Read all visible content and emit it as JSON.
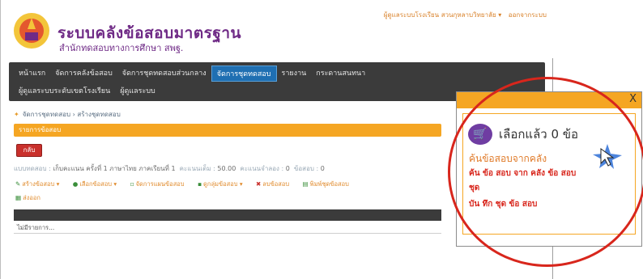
{
  "header": {
    "title": "ระบบคลังข้อสอบมาตรฐาน",
    "subtitle": "สำนักทดสอบทางการศึกษา สพฐ.",
    "top_links": [
      "ผู้ดูแลระบบโรงเรียน สวนกุหลาบวิทยาลัย ▾",
      "ออกจากระบบ"
    ]
  },
  "nav": {
    "row1": [
      "หน้าแรก",
      "จัดการคลังข้อสอบ",
      "จัดการชุดทดสอบส่วนกลาง",
      "จัดการชุดทดสอบ",
      "รายงาน",
      "กระดานสนทนา"
    ],
    "row2": [
      "ผู้ดูแลระบบระดับเขตโรงเรียน",
      "ผู้ดูแลระบบ"
    ],
    "active_index": 3
  },
  "breadcrumb": "จัดการชุดทดสอบ › สร้างชุดทดสอบ",
  "orange_bar": "รายการข้อสอบ",
  "back_button": "กลับ",
  "info": {
    "label1": "แบบทดสอบ :",
    "value1": "เก็บคะแนน ครั้งที่ 1 ภาษาไทย ภาคเรียนที่ 1",
    "label2": "คะแนนเต็ม :",
    "value2": "50.00",
    "label3": "คะแนนจำลอง :",
    "value3": "0",
    "label4": "ข้อสอบ :",
    "value4": "0"
  },
  "tools": [
    "สร้างข้อสอบ ▾",
    "เลือกข้อสอบ ▾",
    "จัดการแผนข้อสอบ",
    "ดูกลุ่มข้อสอบ ▾",
    "ลบข้อสอบ",
    "พิมพ์ชุดข้อสอบ"
  ],
  "tools2": "ส่งออก",
  "table": {
    "empty_text": "ไม่มีรายการ..."
  },
  "popup": {
    "close": "X",
    "cart_text": "เลือกแล้ว 0 ข้อ",
    "search_link": "ค้นข้อสอบจากคลัง",
    "red1": "ค้น ข้อ สอบ จาก คลัง ข้อ สอบ",
    "red2": "ชุด",
    "red3": "บัน ทึก ชุด ข้อ สอบ"
  }
}
